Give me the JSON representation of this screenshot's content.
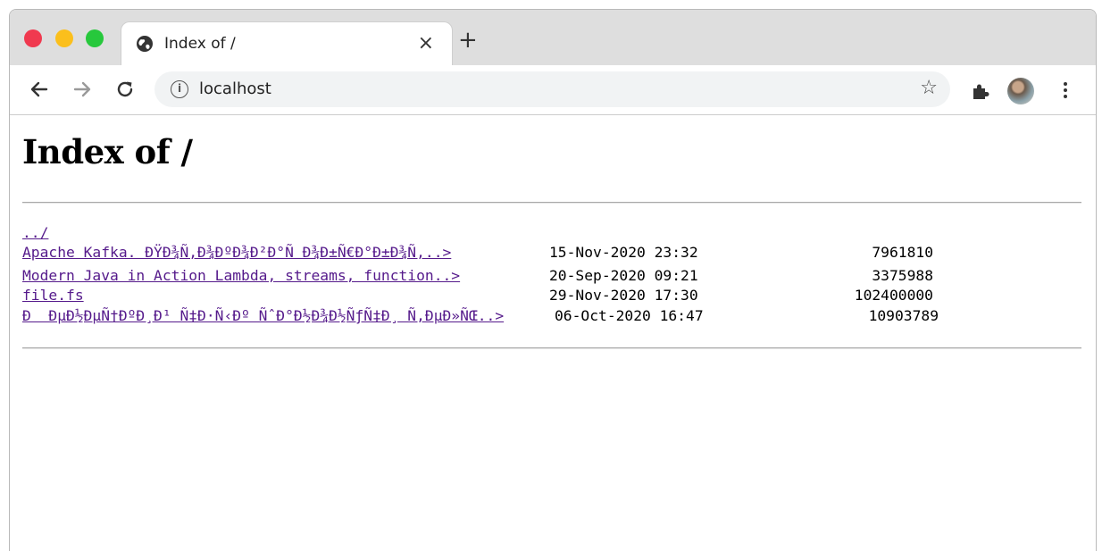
{
  "browser": {
    "tab_title": "Index of /",
    "tab_close_glyph": "×",
    "new_tab_glyph": "+",
    "url": "localhost",
    "star_glyph": "☆"
  },
  "page": {
    "title": "Index of /",
    "entries": [
      {
        "name": "../",
        "date": "",
        "size": ""
      },
      {
        "name": "Apache Kafka. ÐŸÐ¾Ñ‚Ð¾ÐºÐ¾Ð²Ð°Ñ Ð¾Ð±Ñ€Ð°Ð±Ð¾Ñ‚..>",
        "date": "15-Nov-2020 23:32",
        "size": "7961810"
      },
      {
        "name": "Modern Java in Action Lambda, streams, function..>",
        "date": "20-Sep-2020 09:21",
        "size": "3375988"
      },
      {
        "name": "file.fs",
        "date": "29-Nov-2020 17:30",
        "size": "102400000"
      },
      {
        "name": "Ð  ÐµÐ½ÐµÑ†ÐºÐ¸Ð¹ Ñ‡Ð·Ñ‹Ðº ÑˆÐ°Ð½Ð¾Ð½ÑƒÑ‡Ð¸ Ñ‚ÐµÐ»ÑŒ..>",
        "date": "06-Oct-2020 16:47",
        "size": "10903789"
      }
    ]
  },
  "colors": {
    "link": "#551a8b",
    "tabstrip": "#dedede",
    "close_light": "#f0394f",
    "minimize_light": "#fbbf1c",
    "maximize_light": "#27c83c"
  }
}
